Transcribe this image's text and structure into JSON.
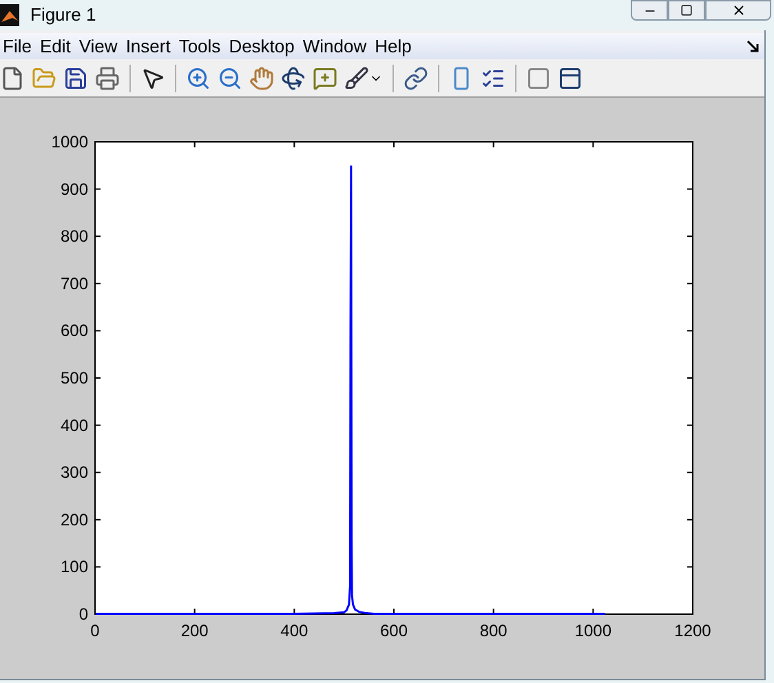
{
  "window": {
    "title": "Figure 1"
  },
  "menu": [
    "File",
    "Edit",
    "View",
    "Insert",
    "Tools",
    "Desktop",
    "Window",
    "Help"
  ],
  "toolbar": [
    {
      "kind": "new"
    },
    {
      "kind": "open"
    },
    {
      "kind": "save"
    },
    {
      "kind": "print"
    },
    {
      "kind": "sep"
    },
    {
      "kind": "pointer"
    },
    {
      "kind": "sep"
    },
    {
      "kind": "zoomin"
    },
    {
      "kind": "zoomout"
    },
    {
      "kind": "pan"
    },
    {
      "kind": "rotate"
    },
    {
      "kind": "cursor"
    },
    {
      "kind": "brush"
    },
    {
      "kind": "sep"
    },
    {
      "kind": "link"
    },
    {
      "kind": "sep"
    },
    {
      "kind": "colorbar"
    },
    {
      "kind": "legend"
    },
    {
      "kind": "sep"
    },
    {
      "kind": "hide"
    },
    {
      "kind": "show"
    }
  ],
  "figure": {
    "chart_data": {
      "type": "line",
      "xlim": [
        0,
        1200
      ],
      "ylim": [
        0,
        1000
      ],
      "xticks": [
        0,
        200,
        400,
        600,
        800,
        1000,
        1200
      ],
      "yticks": [
        0,
        100,
        200,
        300,
        400,
        500,
        600,
        700,
        800,
        900,
        1000
      ],
      "x": [
        1,
        400,
        480,
        500,
        505,
        510,
        512,
        513,
        514,
        515,
        516,
        518,
        522,
        530,
        545,
        560,
        700,
        1024
      ],
      "series": [
        {
          "color": "#0000ff",
          "values": [
            1,
            1,
            2,
            4,
            8,
            20,
            60,
            600,
            950,
            160,
            40,
            20,
            10,
            5,
            2,
            1,
            1,
            1
          ]
        }
      ]
    }
  }
}
